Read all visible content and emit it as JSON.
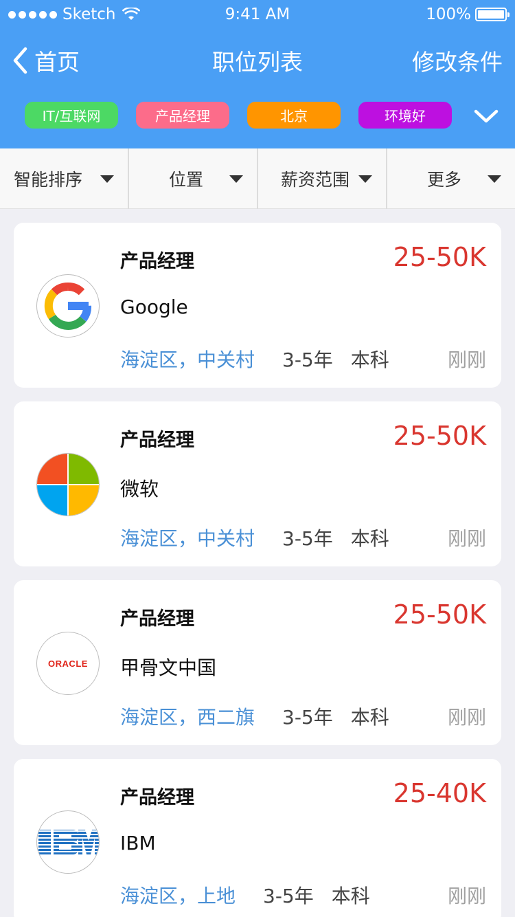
{
  "status_bar": {
    "carrier": "Sketch",
    "time": "9:41 AM",
    "battery": "100%"
  },
  "nav": {
    "back_label": "首页",
    "title": "职位列表",
    "edit_label": "修改条件"
  },
  "tags": [
    {
      "label": "IT/互联网",
      "color": "#4cd964"
    },
    {
      "label": "产品经理",
      "color": "#fc6c8a"
    },
    {
      "label": "北京",
      "color": "#ff9500"
    },
    {
      "label": "环境好",
      "color": "#bd10e0"
    }
  ],
  "filters": [
    {
      "label": "智能排序"
    },
    {
      "label": "位置"
    },
    {
      "label": "薪资范围"
    },
    {
      "label": "更多"
    }
  ],
  "jobs": [
    {
      "title": "产品经理",
      "salary": "25-50K",
      "company": "Google",
      "location": "海淀区，中关村",
      "experience": "3-5年",
      "education": "本科",
      "posted": "刚刚",
      "logo_icon": "google-logo-icon"
    },
    {
      "title": "产品经理",
      "salary": "25-50K",
      "company": "微软",
      "location": "海淀区，中关村",
      "experience": "3-5年",
      "education": "本科",
      "posted": "刚刚",
      "logo_icon": "microsoft-logo-icon"
    },
    {
      "title": "产品经理",
      "salary": "25-50K",
      "company": "甲骨文中国",
      "location": "海淀区，西二旗",
      "experience": "3-5年",
      "education": "本科",
      "posted": "刚刚",
      "logo_icon": "oracle-logo-icon",
      "logo_text": "ORACLE"
    },
    {
      "title": "产品经理",
      "salary": "25-40K",
      "company": "IBM",
      "location": "海淀区，上地",
      "experience": "3-5年",
      "education": "本科",
      "posted": "刚刚",
      "logo_icon": "ibm-logo-icon"
    }
  ],
  "colors": {
    "header": "#4a9ff5",
    "salary": "#d9362f",
    "location": "#4a90d6"
  }
}
